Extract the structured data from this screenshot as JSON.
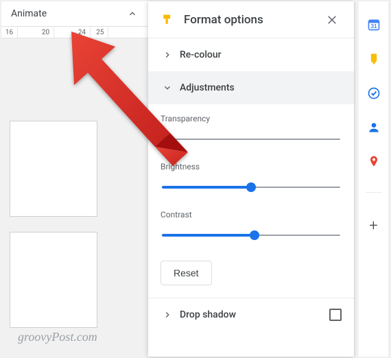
{
  "toolbar": {
    "animate_label": "Animate"
  },
  "ruler_ticks": [
    "16",
    "",
    "20",
    "",
    "24",
    "25"
  ],
  "panel": {
    "title": "Format options",
    "sections": {
      "recolour": {
        "label": "Re-colour"
      },
      "adjustments": {
        "label": "Adjustments",
        "sliders": [
          {
            "name": "Transparency",
            "value_pct": 0
          },
          {
            "name": "Brightness",
            "value_pct": 50
          },
          {
            "name": "Contrast",
            "value_pct": 52
          }
        ],
        "reset_label": "Reset"
      },
      "drop_shadow": {
        "label": "Drop shadow",
        "checked": false
      }
    }
  },
  "watermark": "groovyPost.com",
  "colors": {
    "accent": "#1a73e8",
    "icon_yellow": "#fbbc04",
    "arrow": "#d93025"
  },
  "rail_icons": [
    "calendar-icon",
    "keep-icon",
    "tasks-icon",
    "contacts-icon",
    "maps-icon",
    "plus-icon"
  ]
}
